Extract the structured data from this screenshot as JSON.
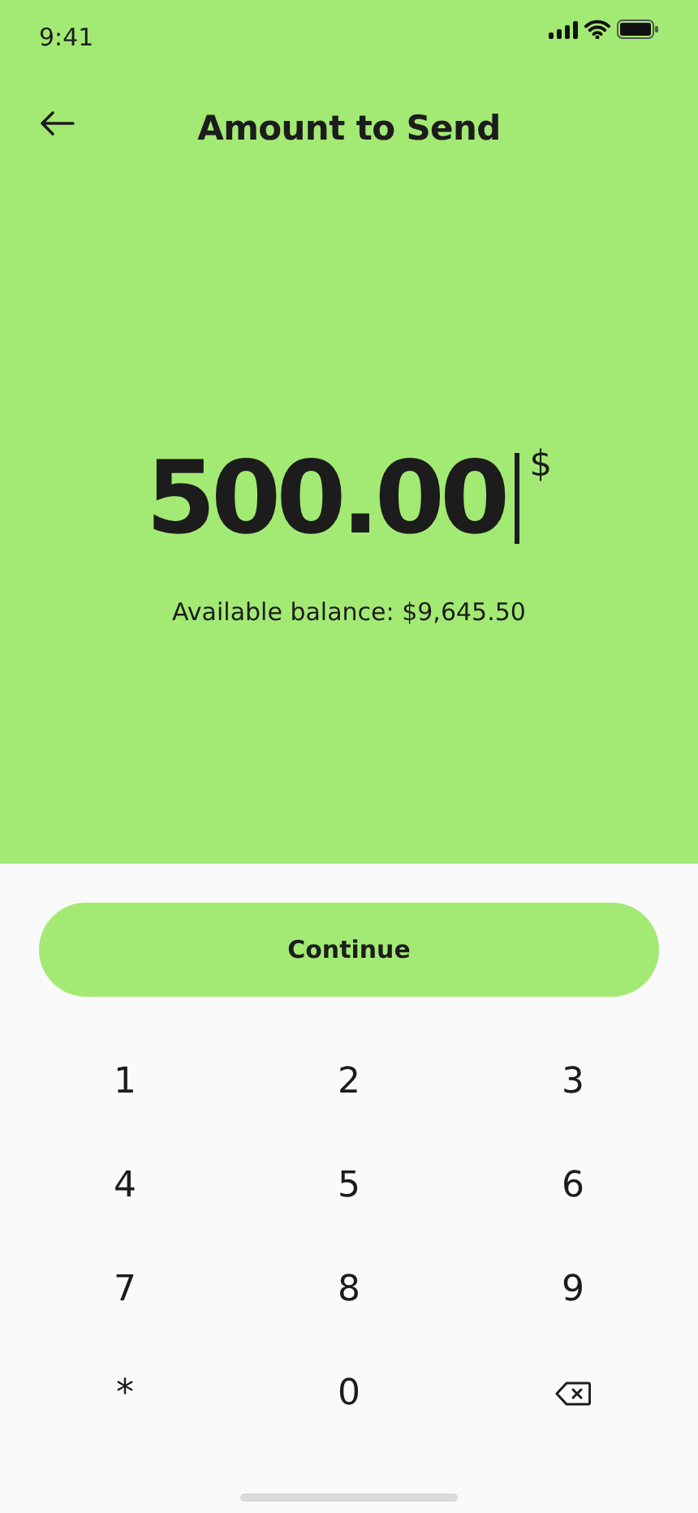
{
  "status_bar": {
    "time": "9:41"
  },
  "header": {
    "title": "Amount to Send"
  },
  "amount": {
    "value": "500.00",
    "currency": "$",
    "balance": "Available balance: $9,645.50"
  },
  "continue_button": {
    "label": "Continue"
  },
  "keypad": [
    {
      "kind": "key",
      "label": "1"
    },
    {
      "kind": "key",
      "label": "2"
    },
    {
      "kind": "key",
      "label": "3"
    },
    {
      "kind": "key",
      "label": "4"
    },
    {
      "kind": "key",
      "label": "5"
    },
    {
      "kind": "key",
      "label": "6"
    },
    {
      "kind": "key",
      "label": "7"
    },
    {
      "kind": "key",
      "label": "8"
    },
    {
      "kind": "key",
      "label": "9"
    },
    {
      "kind": "key",
      "label": "*"
    },
    {
      "kind": "key",
      "label": "0"
    },
    {
      "kind": "backspace"
    }
  ]
}
